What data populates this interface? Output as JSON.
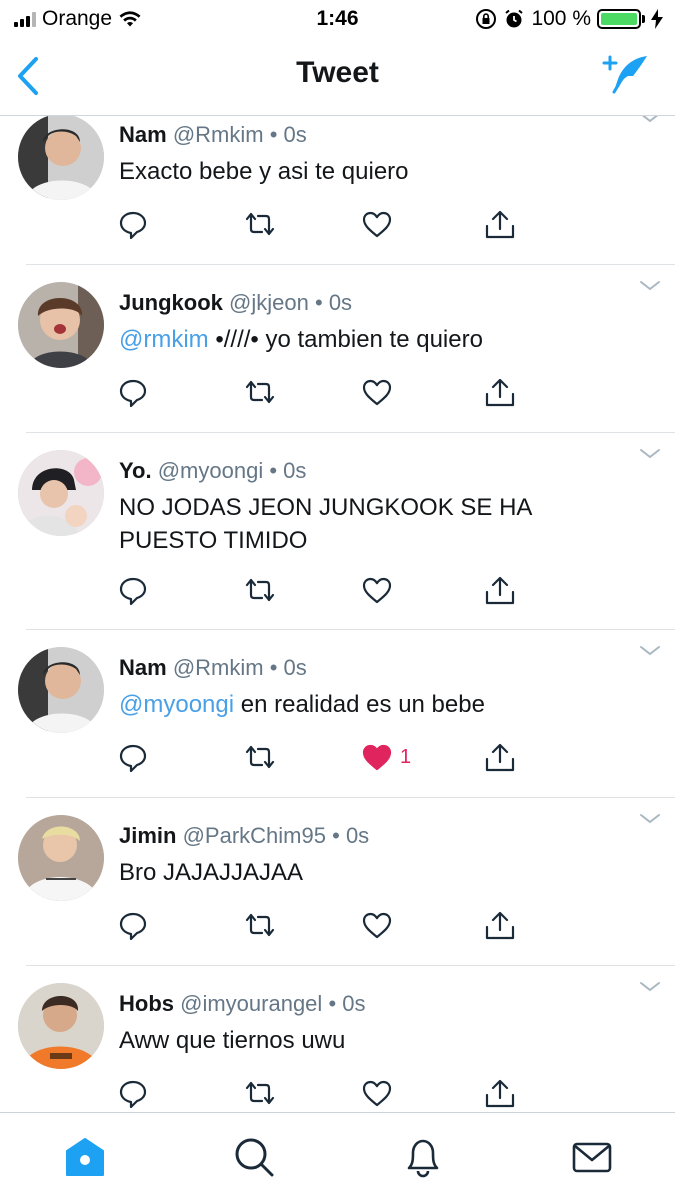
{
  "status_bar": {
    "carrier": "Orange",
    "time": "1:46",
    "battery_percent": "100 %",
    "battery_level": 1.0
  },
  "header": {
    "title": "Tweet",
    "back_icon": "chevron-left-icon",
    "compose_icon": "compose-feather-icon"
  },
  "colors": {
    "accent": "#1da1f2",
    "mention": "#4aa0e6",
    "like": "#e0245e",
    "muted": "#657786",
    "divider": "#dfe3e6"
  },
  "tweets": [
    {
      "name": "Nam",
      "handle": "@Rmkim",
      "dot": "•",
      "time": "0s",
      "mention": "",
      "text": "Exacto bebe y asi te quiero",
      "liked": false,
      "like_count": ""
    },
    {
      "name": "Jungkook",
      "handle": "@jkjeon",
      "dot": "•",
      "time": "0s",
      "mention": "@rmkim",
      "text": " •////• yo tambien te quiero",
      "liked": false,
      "like_count": ""
    },
    {
      "name": "Yo.",
      "handle": "@myoongi",
      "dot": "•",
      "time": "0s",
      "mention": "",
      "text": "NO JODAS JEON JUNGKOOK SE HA PUESTO TIMIDO",
      "liked": false,
      "like_count": ""
    },
    {
      "name": "Nam",
      "handle": "@Rmkim",
      "dot": "•",
      "time": "0s",
      "mention": "@myoongi",
      "text": " en realidad es un bebe",
      "liked": true,
      "like_count": "1"
    },
    {
      "name": "Jimin",
      "handle": "@ParkChim95",
      "dot": "•",
      "time": "0s",
      "mention": "",
      "text": "Bro JAJAJJAJAA",
      "liked": false,
      "like_count": ""
    },
    {
      "name": "Hobs",
      "handle": "@imyourangel",
      "dot": "•",
      "time": "0s",
      "mention": "",
      "text": "Aww que tiernos uwu",
      "liked": false,
      "like_count": ""
    }
  ],
  "tab_bar": {
    "items": [
      {
        "icon": "home-icon",
        "active": true
      },
      {
        "icon": "search-icon",
        "active": false
      },
      {
        "icon": "bell-icon",
        "active": false
      },
      {
        "icon": "mail-icon",
        "active": false
      }
    ]
  }
}
